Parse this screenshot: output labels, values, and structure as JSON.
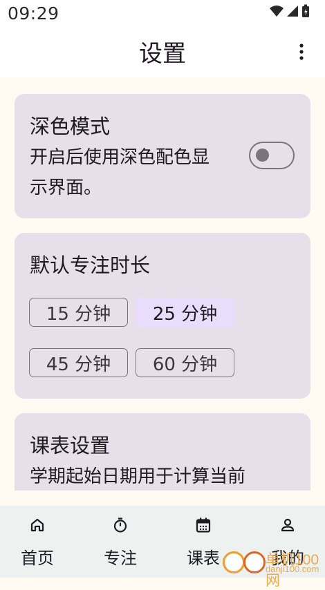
{
  "status": {
    "time": "09:29"
  },
  "header": {
    "title": "设置"
  },
  "dark_mode": {
    "title": "深色模式",
    "desc_line1": "开启后使用深色配色显",
    "desc_line2": "示界面。",
    "enabled": false
  },
  "focus_duration": {
    "title": "默认专注时长",
    "options": [
      "15 分钟",
      "25 分钟",
      "45 分钟",
      "60 分钟"
    ],
    "selected": "25 分钟"
  },
  "schedule": {
    "title": "课表设置",
    "desc_partial": "学期起始日期用于计算当前"
  },
  "nav": {
    "items": [
      {
        "label": "首页",
        "icon": "home-icon"
      },
      {
        "label": "专注",
        "icon": "timer-icon"
      },
      {
        "label": "课表",
        "icon": "calendar-icon"
      },
      {
        "label": "我的",
        "icon": "person-icon"
      }
    ]
  },
  "watermark": {
    "text": "单机100网",
    "url": "danji100.com"
  }
}
